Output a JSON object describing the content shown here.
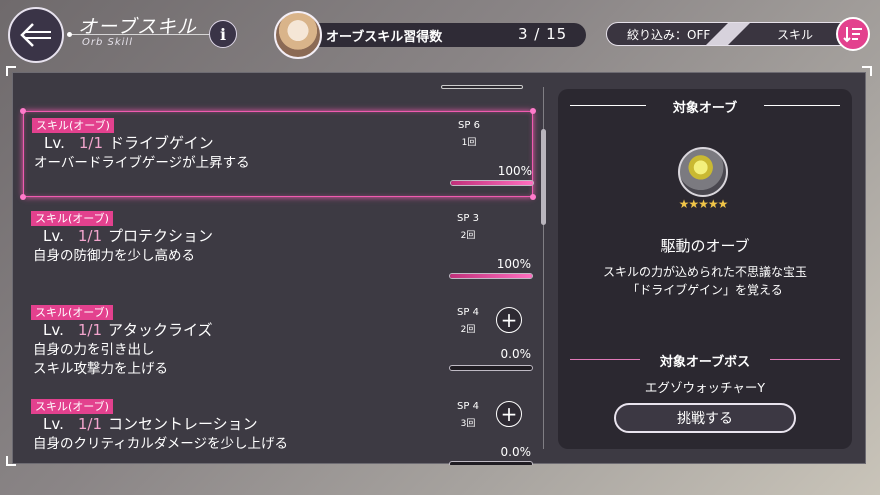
{
  "header": {
    "title": "オーブスキル",
    "subtitle": "Orb Skill",
    "info_label": "i"
  },
  "progress": {
    "label": "オーブスキル習得数",
    "count": "3 / 15"
  },
  "filter": {
    "label": "絞り込み：OFF",
    "skill_label": "スキル"
  },
  "skills": [
    {
      "tag": "スキル(オーブ)",
      "lv_label": "Lv.",
      "lv_value": "1/1",
      "name": "ドライブゲイン",
      "desc_lines": [
        "オーバードライブゲージが上昇する"
      ],
      "sp": "SP 6",
      "times": "1回",
      "percent_text": "100%",
      "progress": 1.0,
      "has_plus": false,
      "selected": true
    },
    {
      "tag": "スキル(オーブ)",
      "lv_label": "Lv.",
      "lv_value": "1/1",
      "name": "プロテクション",
      "desc_lines": [
        "自身の防御力を少し高める"
      ],
      "sp": "SP 3",
      "times": "2回",
      "percent_text": "100%",
      "progress": 1.0,
      "has_plus": false,
      "selected": false
    },
    {
      "tag": "スキル(オーブ)",
      "lv_label": "Lv.",
      "lv_value": "1/1",
      "name": "アタックライズ",
      "desc_lines": [
        "自身の力を引き出し",
        "スキル攻撃力を上げる"
      ],
      "sp": "SP 4",
      "times": "2回",
      "percent_text": "0.0%",
      "progress": 0.0,
      "has_plus": true,
      "selected": false
    },
    {
      "tag": "スキル(オーブ)",
      "lv_label": "Lv.",
      "lv_value": "1/1",
      "name": "コンセントレーション",
      "desc_lines": [
        "自身のクリティカルダメージを少し上げる"
      ],
      "sp": "SP 4",
      "times": "3回",
      "percent_text": "0.0%",
      "progress": 0.0,
      "has_plus": true,
      "selected": false
    }
  ],
  "detail": {
    "section_title": "対象オーブ",
    "orb_icon": "orb-icon",
    "stars": "★★★★★",
    "star_count": 5,
    "orb_name": "駆動のオーブ",
    "orb_desc_line1": "スキルの力が込められた不思議な宝玉",
    "orb_desc_line2": "「ドライブゲイン」を覚える",
    "boss_section_title": "対象オーブボス",
    "boss_name": "エグゾウォッチャーY",
    "challenge_label": "挑戦する"
  },
  "colors": {
    "accent": "#e3418e",
    "panel": "#3d3a43",
    "detail_bg": "#2b2830",
    "lv_value": "#f2a5cd"
  }
}
